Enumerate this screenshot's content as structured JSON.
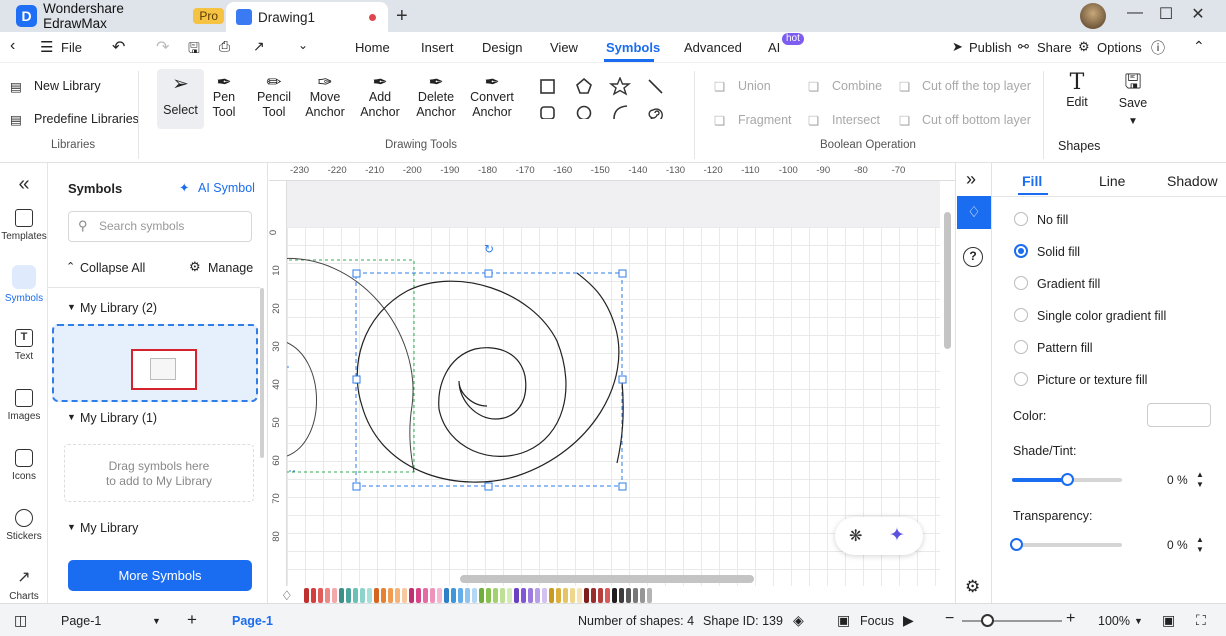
{
  "titlebar": {
    "app_name": "Wondershare EdrawMax",
    "pro_badge": "Pro",
    "doc_title": "Drawing1",
    "new_tab": "+"
  },
  "menubar": {
    "file": "File",
    "tabs": [
      "Home",
      "Insert",
      "Design",
      "View",
      "Symbols",
      "Advanced",
      "AI"
    ],
    "hot_badge": "hot",
    "actions": {
      "publish": "Publish",
      "share": "Share",
      "options": "Options"
    }
  },
  "ribbon": {
    "libraries": {
      "new_library": "New Library",
      "predefine": "Predefine Libraries",
      "group": "Libraries"
    },
    "drawing": {
      "select": "Select",
      "pen_1": "Pen",
      "pen_2": "Tool",
      "pencil_1": "Pencil",
      "pencil_2": "Tool",
      "move_1": "Move",
      "move_2": "Anchor",
      "add_1": "Add",
      "add_2": "Anchor",
      "delete_1": "Delete",
      "delete_2": "Anchor",
      "convert_1": "Convert",
      "convert_2": "Anchor",
      "group": "Drawing Tools"
    },
    "boolean": {
      "union": "Union",
      "combine": "Combine",
      "cut_top": "Cut off the top layer",
      "fragment": "Fragment",
      "intersect": "Intersect",
      "cut_bottom": "Cut off bottom layer",
      "group": "Boolean Operation"
    },
    "edit": "Edit",
    "save": "Save",
    "shapes": "Shapes"
  },
  "rail": [
    "Templates",
    "Symbols",
    "Text",
    "Images",
    "Icons",
    "Stickers",
    "Charts"
  ],
  "symbols_panel": {
    "title": "Symbols",
    "ai_symbol": "AI Symbol",
    "search_placeholder": "Search symbols",
    "collapse": "Collapse All",
    "manage": "Manage",
    "lib1": "My Library (2)",
    "lib2": "My Library (1)",
    "drop_1": "Drag symbols here",
    "drop_2": "to add to My Library",
    "lib3": "My Library",
    "more": "More Symbols"
  },
  "ruler": {
    "top": [
      "-230",
      "-220",
      "-210",
      "-200",
      "-190",
      "-180",
      "-170",
      "-160",
      "-150",
      "-140",
      "-130",
      "-120",
      "-110",
      "-100",
      "-90",
      "-80",
      "-70"
    ],
    "left": [
      "0",
      "10",
      "20",
      "30",
      "40",
      "50",
      "60",
      "70",
      "80"
    ]
  },
  "palette": [
    "#c0302f",
    "#d73c3c",
    "#e25b5b",
    "#ec8a8a",
    "#f3a9a9",
    "#3b8f8a",
    "#4ba59f",
    "#6cc0b8",
    "#8bd3cc",
    "#a8dfd9",
    "#d4661f",
    "#e88033",
    "#f09a52",
    "#f5b37a",
    "#f8c9a0",
    "#c22f6f",
    "#d84687",
    "#e66aa2",
    "#ee91bb",
    "#f4b6d1",
    "#2d7fc7",
    "#3f96db",
    "#64acea",
    "#8ec4f1",
    "#b3d8f6",
    "#6fae3b",
    "#86c24c",
    "#a2d26f",
    "#bde093",
    "#d3ebb5",
    "#6a3fc0",
    "#8158d4",
    "#9c7ae0",
    "#b89de9",
    "#d2c1f1",
    "#c99a1e",
    "#dcb03a",
    "#e6c463",
    "#efd68d",
    "#f5e4b2",
    "#7f1d1d",
    "#9b2c2c",
    "#b83e3e",
    "#d65c5c",
    "#1e1e1e",
    "#3c3c3c",
    "#5a5a5a",
    "#787878",
    "#969696",
    "#b4b4b4"
  ],
  "right_panel": {
    "tabs": [
      "Fill",
      "Line",
      "Shadow"
    ],
    "options": [
      "No fill",
      "Solid fill",
      "Gradient fill",
      "Single color gradient fill",
      "Pattern fill",
      "Picture or texture fill"
    ],
    "selected": "Solid fill",
    "color_label": "Color:",
    "shade_label": "Shade/Tint:",
    "shade_value": "0 %",
    "shade_level": 0.5,
    "transparency_label": "Transparency:",
    "transparency_value": "0 %",
    "transparency_level": 0
  },
  "statusbar": {
    "page_select": "Page-1",
    "active_page": "Page-1",
    "shape_count": "Number of shapes: 4",
    "shape_id": "Shape ID: 139",
    "focus": "Focus",
    "zoom": "100%"
  }
}
